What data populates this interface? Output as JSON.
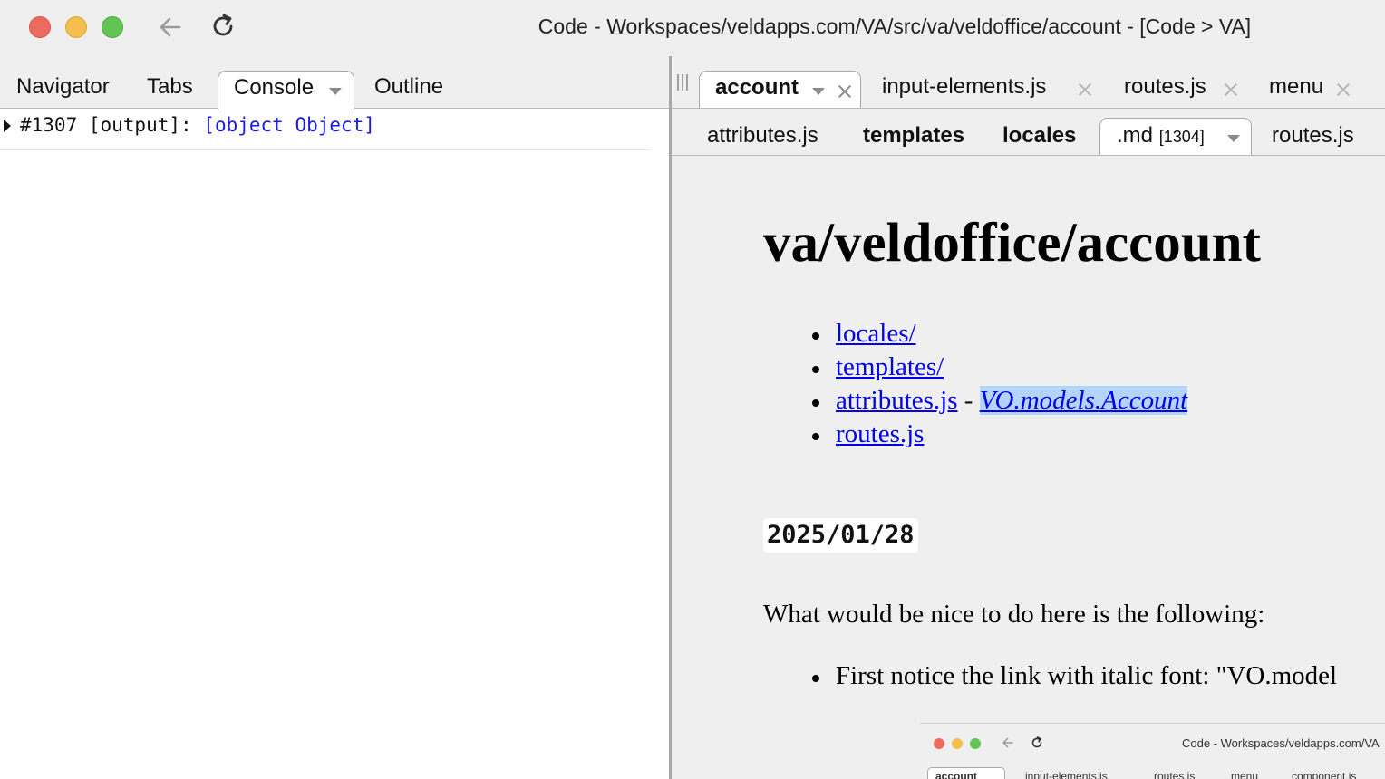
{
  "window": {
    "title": "Code - Workspaces/veldapps.com/VA/src/va/veldoffice/account - [Code > VA]"
  },
  "left_pane": {
    "tabs": [
      {
        "label": "Navigator",
        "active": false
      },
      {
        "label": "Tabs",
        "active": false
      },
      {
        "label": "Console",
        "active": true
      },
      {
        "label": "Outline",
        "active": false
      }
    ],
    "console": {
      "entries": [
        {
          "prefix": "#1307 [output]: ",
          "value": "[object Object]"
        }
      ]
    }
  },
  "right_pane": {
    "file_tabs": [
      {
        "label": "account",
        "active": true
      },
      {
        "label": "input-elements.js",
        "active": false
      },
      {
        "label": "routes.js",
        "active": false
      },
      {
        "label": "menu",
        "active": false
      }
    ],
    "sub_tabs": [
      {
        "label": "attributes.js",
        "bold": false
      },
      {
        "label": "templates",
        "bold": true
      },
      {
        "label": "locales",
        "bold": true
      },
      {
        "label": ".md",
        "count": "[1304]",
        "active": true
      },
      {
        "label": "routes.js",
        "bold": false
      }
    ],
    "document": {
      "heading": "va/veldoffice/account",
      "links": [
        {
          "label": "locales/"
        },
        {
          "label": "templates/"
        },
        {
          "label": "attributes.js",
          "separator": " - ",
          "extra": "VO.models.Account"
        },
        {
          "label": "routes.js"
        }
      ],
      "date": "2025/01/28",
      "paragraph": "What would be nice to do here is the following:",
      "bullet": "First notice the link with italic font: \"VO.model"
    },
    "thumbnail": {
      "title": "Code - Workspaces/veldapps.com/VA",
      "tabs": [
        "account",
        "input-elements.js",
        "routes.js",
        "menu",
        "component.js"
      ]
    }
  },
  "colors": {
    "link": "#0000ee",
    "selection": "#b3d4fb",
    "console_object": "#1a1aee",
    "traffic_red": "#ed6a5e",
    "traffic_yellow": "#f5bf4f",
    "traffic_green": "#61c554"
  },
  "icons": [
    "back-arrow-icon",
    "reload-icon",
    "close-icon",
    "chevron-down-icon",
    "expand-triangle-icon",
    "drag-grip-icon"
  ]
}
